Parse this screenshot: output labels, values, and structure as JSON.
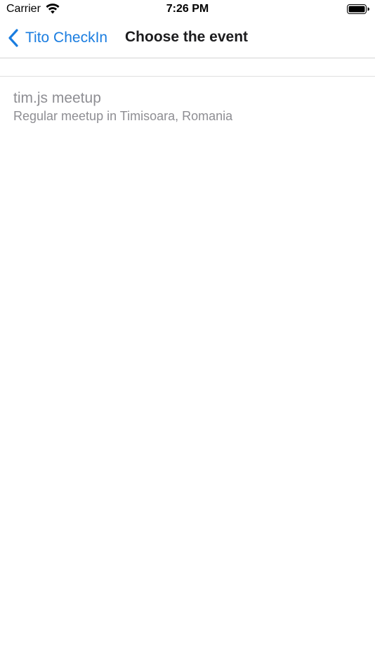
{
  "status_bar": {
    "carrier": "Carrier",
    "time": "7:26 PM"
  },
  "nav": {
    "back_label": "Tito CheckIn",
    "title": "Choose the event"
  },
  "events": [
    {
      "title": "tim.js meetup",
      "subtitle": "Regular meetup in Timisoara, Romania"
    }
  ],
  "colors": {
    "accent": "#1a7de0",
    "item_text": "#8e8e93",
    "title_text": "#1c1c1e"
  }
}
